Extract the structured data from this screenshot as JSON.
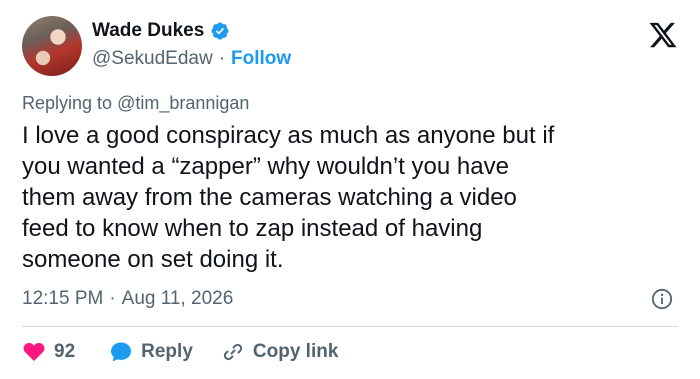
{
  "author": {
    "display_name": "Wade Dukes",
    "handle": "@SekudEdaw",
    "separator": "·",
    "follow_label": "Follow",
    "verified": true
  },
  "reply": {
    "prefix": "Replying to ",
    "handle": "@tim_brannigan"
  },
  "tweet": {
    "text": "I love a good conspiracy as much as anyone but if\nyou wanted a “zapper” why wouldn’t you have\nthem away from the cameras watching a video\nfeed to know when to zap instead of having\nsomeone on set doing it."
  },
  "meta": {
    "time": "12:15 PM",
    "separator": "·",
    "date": "Aug 11, 2026"
  },
  "actions": {
    "like_count": "92",
    "reply_label": "Reply",
    "copy_link_label": "Copy link"
  },
  "colors": {
    "accent": "#1d9bf0",
    "like": "#f91880",
    "text": "#0f1419",
    "muted": "#536471",
    "divider": "#cfd9de"
  },
  "icons": [
    "verified-badge-icon",
    "x-logo-icon",
    "info-icon",
    "heart-icon",
    "reply-bubble-icon",
    "link-icon"
  ]
}
